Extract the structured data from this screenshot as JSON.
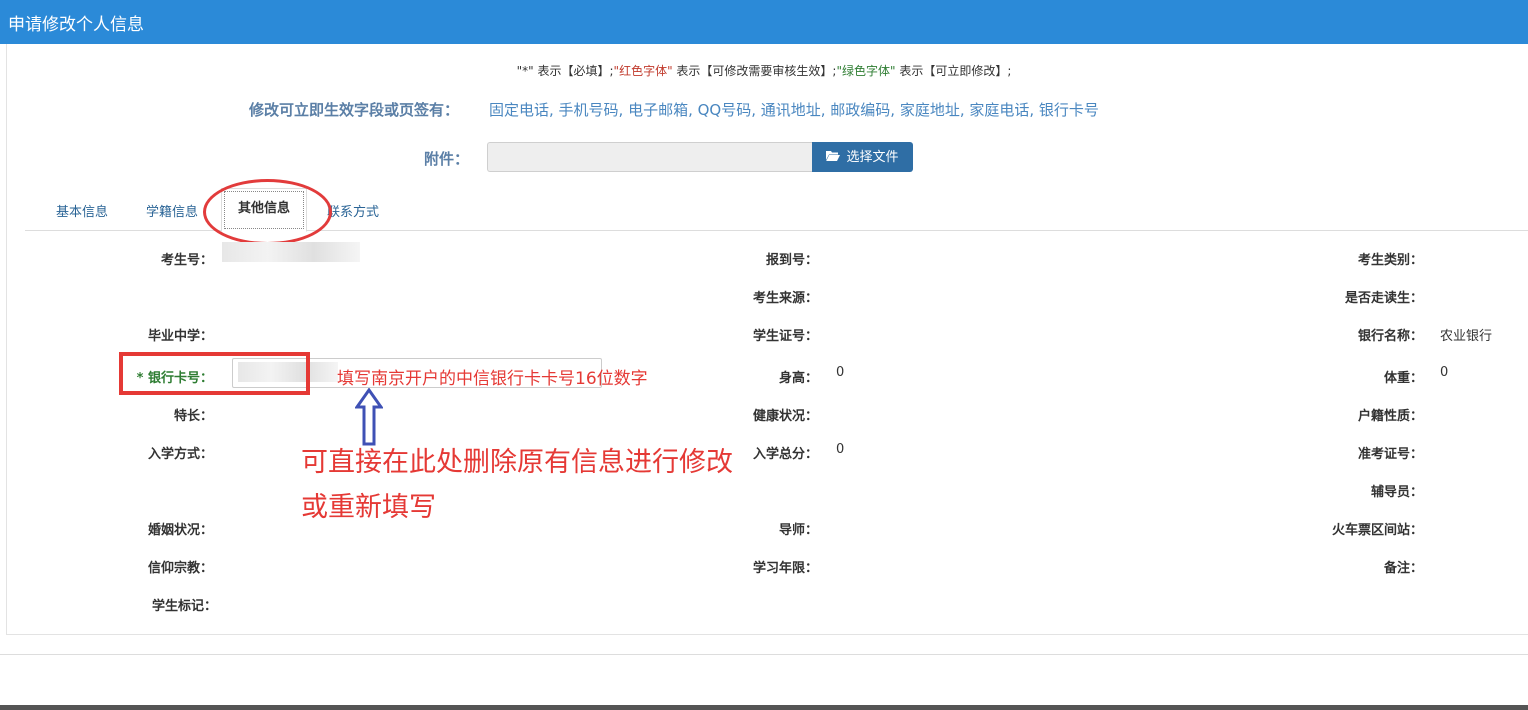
{
  "window": {
    "title": "申请修改个人信息"
  },
  "legend": {
    "part1": "\"*\" 表示【必填】;",
    "part2_red": "\"红色字体\"",
    "part3": " 表示【可修改需要审核生效】;",
    "part4_green": "\"绿色字体\"",
    "part5": " 表示【可立即修改】;"
  },
  "instant": {
    "label": "修改可立即生效字段或页签有：",
    "fields": "固定电话, 手机号码, 电子邮箱, QQ号码, 通讯地址, 邮政编码, 家庭地址, 家庭电话, 银行卡号"
  },
  "attachment": {
    "label": "附件：",
    "button_label": "选择文件",
    "button_icon": "folder-open-icon"
  },
  "tabs": [
    {
      "label": "基本信息"
    },
    {
      "label": "学籍信息"
    },
    {
      "label": "其他信息",
      "active": true
    },
    {
      "label": "联系方式"
    }
  ],
  "form": {
    "exam_no": {
      "label": "考生号："
    },
    "report_no": {
      "label": "报到号："
    },
    "exam_type": {
      "label": "考生类别："
    },
    "exam_source": {
      "label": "考生来源："
    },
    "commuter": {
      "label": "是否走读生："
    },
    "high_school": {
      "label": "毕业中学："
    },
    "student_id_no": {
      "label": "学生证号："
    },
    "bank_name": {
      "label": "银行名称：",
      "value": "农业银行"
    },
    "bank_card": {
      "label": "* 银行卡号：",
      "hint": "填写南京开户的中信银行卡卡号16位数字"
    },
    "height": {
      "label": "身高：",
      "value": "0"
    },
    "weight": {
      "label": "体重：",
      "value": "0"
    },
    "specialty": {
      "label": "特长："
    },
    "health": {
      "label": "健康状况："
    },
    "household": {
      "label": "户籍性质："
    },
    "admission_mode": {
      "label": "入学方式："
    },
    "total_score": {
      "label": "入学总分：",
      "value": "0"
    },
    "admission_ticket": {
      "label": "准考证号："
    },
    "counselor": {
      "label": "辅导员："
    },
    "marital": {
      "label": "婚姻状况："
    },
    "tutor": {
      "label": "导师："
    },
    "train_station": {
      "label": "火车票区间站："
    },
    "religion": {
      "label": "信仰宗教："
    },
    "years": {
      "label": "学习年限："
    },
    "remark": {
      "label": "备注："
    },
    "student_mark": {
      "label": "学生标记："
    }
  },
  "annotation": {
    "line1": "可直接在此处删除原有信息进行修改",
    "line2": "或重新填写"
  },
  "colors": {
    "titlebar": "#2b8ad8",
    "annotation": "#e53935",
    "arrow": "#3f51b5",
    "button": "#2f6ea5"
  }
}
